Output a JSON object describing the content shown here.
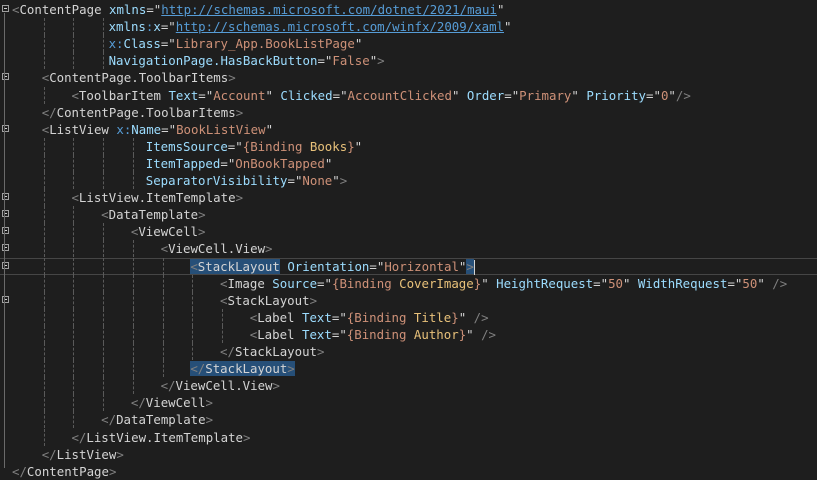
{
  "editor": {
    "language": "XAML",
    "theme_colors": {
      "background": "#1e1e1e",
      "attribute": "#9cdcfe",
      "value": "#ce9178",
      "punctuation": "#808080",
      "selection": "#264f78"
    },
    "lines": [
      {
        "indent": 0,
        "fold": true,
        "tokens": [
          [
            "b",
            "<"
          ],
          [
            "t",
            "ContentPage"
          ],
          [
            "m",
            " "
          ],
          [
            "a",
            "xmlns"
          ],
          [
            "q",
            "="
          ],
          [
            "q",
            "\""
          ],
          [
            "u",
            "http://schemas.microsoft.com/dotnet/2021/maui"
          ],
          [
            "q",
            "\""
          ]
        ]
      },
      {
        "indent": 13,
        "tokens": [
          [
            "a",
            "xmlns"
          ],
          [
            "p",
            ":"
          ],
          [
            "a",
            "x"
          ],
          [
            "q",
            "="
          ],
          [
            "q",
            "\""
          ],
          [
            "u",
            "http://schemas.microsoft.com/winfx/2009/xaml"
          ],
          [
            "q",
            "\""
          ]
        ]
      },
      {
        "indent": 13,
        "tokens": [
          [
            "p",
            "x"
          ],
          [
            "p",
            ":"
          ],
          [
            "a",
            "Class"
          ],
          [
            "q",
            "="
          ],
          [
            "q",
            "\""
          ],
          [
            "v",
            "Library_App.BookListPage"
          ],
          [
            "q",
            "\""
          ]
        ]
      },
      {
        "indent": 13,
        "tokens": [
          [
            "a",
            "NavigationPage.HasBackButton"
          ],
          [
            "q",
            "="
          ],
          [
            "q",
            "\""
          ],
          [
            "v",
            "False"
          ],
          [
            "q",
            "\""
          ],
          [
            "b",
            ">"
          ]
        ]
      },
      {
        "indent": 4,
        "fold": true,
        "tokens": [
          [
            "b",
            "<"
          ],
          [
            "t",
            "ContentPage.ToolbarItems"
          ],
          [
            "b",
            ">"
          ]
        ]
      },
      {
        "indent": 8,
        "tokens": [
          [
            "b",
            "<"
          ],
          [
            "t",
            "ToolbarItem"
          ],
          [
            "m",
            " "
          ],
          [
            "a",
            "Text"
          ],
          [
            "q",
            "="
          ],
          [
            "q",
            "\""
          ],
          [
            "v",
            "Account"
          ],
          [
            "q",
            "\""
          ],
          [
            "m",
            " "
          ],
          [
            "a",
            "Clicked"
          ],
          [
            "q",
            "="
          ],
          [
            "q",
            "\""
          ],
          [
            "v",
            "AccountClicked"
          ],
          [
            "q",
            "\""
          ],
          [
            "m",
            " "
          ],
          [
            "a",
            "Order"
          ],
          [
            "q",
            "="
          ],
          [
            "q",
            "\""
          ],
          [
            "v",
            "Primary"
          ],
          [
            "q",
            "\""
          ],
          [
            "m",
            " "
          ],
          [
            "a",
            "Priority"
          ],
          [
            "q",
            "="
          ],
          [
            "q",
            "\""
          ],
          [
            "v",
            "0"
          ],
          [
            "q",
            "\""
          ],
          [
            "b",
            "/>"
          ]
        ]
      },
      {
        "indent": 4,
        "tokens": [
          [
            "b",
            "</"
          ],
          [
            "t",
            "ContentPage.ToolbarItems"
          ],
          [
            "b",
            ">"
          ]
        ]
      },
      {
        "indent": 4,
        "fold": true,
        "tokens": [
          [
            "b",
            "<"
          ],
          [
            "t",
            "ListView"
          ],
          [
            "m",
            " "
          ],
          [
            "p",
            "x"
          ],
          [
            "p",
            ":"
          ],
          [
            "a",
            "Name"
          ],
          [
            "q",
            "="
          ],
          [
            "q",
            "\""
          ],
          [
            "v",
            "BookListView"
          ],
          [
            "q",
            "\""
          ]
        ]
      },
      {
        "indent": 18,
        "tokens": [
          [
            "a",
            "ItemsSource"
          ],
          [
            "q",
            "="
          ],
          [
            "q",
            "\""
          ],
          [
            "bd",
            "{Binding "
          ],
          [
            "bk",
            "Books"
          ],
          [
            "bd",
            "}"
          ],
          [
            "q",
            "\""
          ]
        ]
      },
      {
        "indent": 18,
        "tokens": [
          [
            "a",
            "ItemTapped"
          ],
          [
            "q",
            "="
          ],
          [
            "q",
            "\""
          ],
          [
            "v",
            "OnBookTapped"
          ],
          [
            "q",
            "\""
          ]
        ]
      },
      {
        "indent": 18,
        "tokens": [
          [
            "a",
            "SeparatorVisibility"
          ],
          [
            "q",
            "="
          ],
          [
            "q",
            "\""
          ],
          [
            "v",
            "None"
          ],
          [
            "q",
            "\""
          ],
          [
            "b",
            ">"
          ]
        ]
      },
      {
        "indent": 8,
        "fold": true,
        "tokens": [
          [
            "b",
            "<"
          ],
          [
            "t",
            "ListView.ItemTemplate"
          ],
          [
            "b",
            ">"
          ]
        ]
      },
      {
        "indent": 12,
        "fold": true,
        "tokens": [
          [
            "b",
            "<"
          ],
          [
            "t",
            "DataTemplate"
          ],
          [
            "b",
            ">"
          ]
        ]
      },
      {
        "indent": 16,
        "fold": true,
        "tokens": [
          [
            "b",
            "<"
          ],
          [
            "t",
            "ViewCell"
          ],
          [
            "b",
            ">"
          ]
        ]
      },
      {
        "indent": 20,
        "fold": true,
        "tokens": [
          [
            "b",
            "<"
          ],
          [
            "t",
            "ViewCell.View"
          ],
          [
            "b",
            ">"
          ]
        ]
      },
      {
        "indent": 24,
        "fold": true,
        "current": true,
        "tokens": [
          [
            "b",
            "<",
            "hl"
          ],
          [
            "t",
            "StackLayout",
            "hl"
          ],
          [
            "m",
            " "
          ],
          [
            "a",
            "Orientation"
          ],
          [
            "q",
            "="
          ],
          [
            "q",
            "\""
          ],
          [
            "v",
            "Horizontal"
          ],
          [
            "q",
            "\""
          ],
          [
            "b",
            ">",
            "hl"
          ],
          [
            "caret",
            ""
          ]
        ]
      },
      {
        "indent": 28,
        "tokens": [
          [
            "b",
            "<"
          ],
          [
            "t",
            "Image"
          ],
          [
            "m",
            " "
          ],
          [
            "a",
            "Source"
          ],
          [
            "q",
            "="
          ],
          [
            "q",
            "\""
          ],
          [
            "bd",
            "{Binding "
          ],
          [
            "bk",
            "CoverImage"
          ],
          [
            "bd",
            "}"
          ],
          [
            "q",
            "\""
          ],
          [
            "m",
            " "
          ],
          [
            "a",
            "HeightRequest"
          ],
          [
            "q",
            "="
          ],
          [
            "q",
            "\""
          ],
          [
            "v",
            "50"
          ],
          [
            "q",
            "\""
          ],
          [
            "m",
            " "
          ],
          [
            "a",
            "WidthRequest"
          ],
          [
            "q",
            "="
          ],
          [
            "q",
            "\""
          ],
          [
            "v",
            "50"
          ],
          [
            "q",
            "\""
          ],
          [
            "m",
            " "
          ],
          [
            "b",
            "/>"
          ]
        ]
      },
      {
        "indent": 28,
        "fold": true,
        "tokens": [
          [
            "b",
            "<"
          ],
          [
            "t",
            "StackLayout"
          ],
          [
            "b",
            ">"
          ]
        ]
      },
      {
        "indent": 32,
        "tokens": [
          [
            "b",
            "<"
          ],
          [
            "t",
            "Label"
          ],
          [
            "m",
            " "
          ],
          [
            "a",
            "Text"
          ],
          [
            "q",
            "="
          ],
          [
            "q",
            "\""
          ],
          [
            "bd",
            "{Binding "
          ],
          [
            "bk",
            "Title"
          ],
          [
            "bd",
            "}"
          ],
          [
            "q",
            "\""
          ],
          [
            "m",
            " "
          ],
          [
            "b",
            "/>"
          ]
        ]
      },
      {
        "indent": 32,
        "tokens": [
          [
            "b",
            "<"
          ],
          [
            "t",
            "Label"
          ],
          [
            "m",
            " "
          ],
          [
            "a",
            "Text"
          ],
          [
            "q",
            "="
          ],
          [
            "q",
            "\""
          ],
          [
            "bd",
            "{Binding "
          ],
          [
            "bk",
            "Author"
          ],
          [
            "bd",
            "}"
          ],
          [
            "q",
            "\""
          ],
          [
            "m",
            " "
          ],
          [
            "b",
            "/>"
          ]
        ]
      },
      {
        "indent": 28,
        "tokens": [
          [
            "b",
            "</"
          ],
          [
            "t",
            "StackLayout"
          ],
          [
            "b",
            ">"
          ]
        ]
      },
      {
        "indent": 24,
        "tokens": [
          [
            "b",
            "</",
            "hl"
          ],
          [
            "t",
            "StackLayout",
            "hl"
          ],
          [
            "b",
            ">",
            "hl"
          ]
        ]
      },
      {
        "indent": 20,
        "tokens": [
          [
            "b",
            "</"
          ],
          [
            "t",
            "ViewCell.View"
          ],
          [
            "b",
            ">"
          ]
        ]
      },
      {
        "indent": 16,
        "tokens": [
          [
            "b",
            "</"
          ],
          [
            "t",
            "ViewCell"
          ],
          [
            "b",
            ">"
          ]
        ]
      },
      {
        "indent": 12,
        "tokens": [
          [
            "b",
            "</"
          ],
          [
            "t",
            "DataTemplate"
          ],
          [
            "b",
            ">"
          ]
        ]
      },
      {
        "indent": 8,
        "tokens": [
          [
            "b",
            "</"
          ],
          [
            "t",
            "ListView.ItemTemplate"
          ],
          [
            "b",
            ">"
          ]
        ]
      },
      {
        "indent": 4,
        "tokens": [
          [
            "b",
            "</"
          ],
          [
            "t",
            "ListView"
          ],
          [
            "b",
            ">"
          ]
        ]
      },
      {
        "indent": 0,
        "tokens": [
          [
            "b",
            "</"
          ],
          [
            "t",
            "ContentPage"
          ],
          [
            "b",
            ">"
          ]
        ]
      }
    ]
  }
}
